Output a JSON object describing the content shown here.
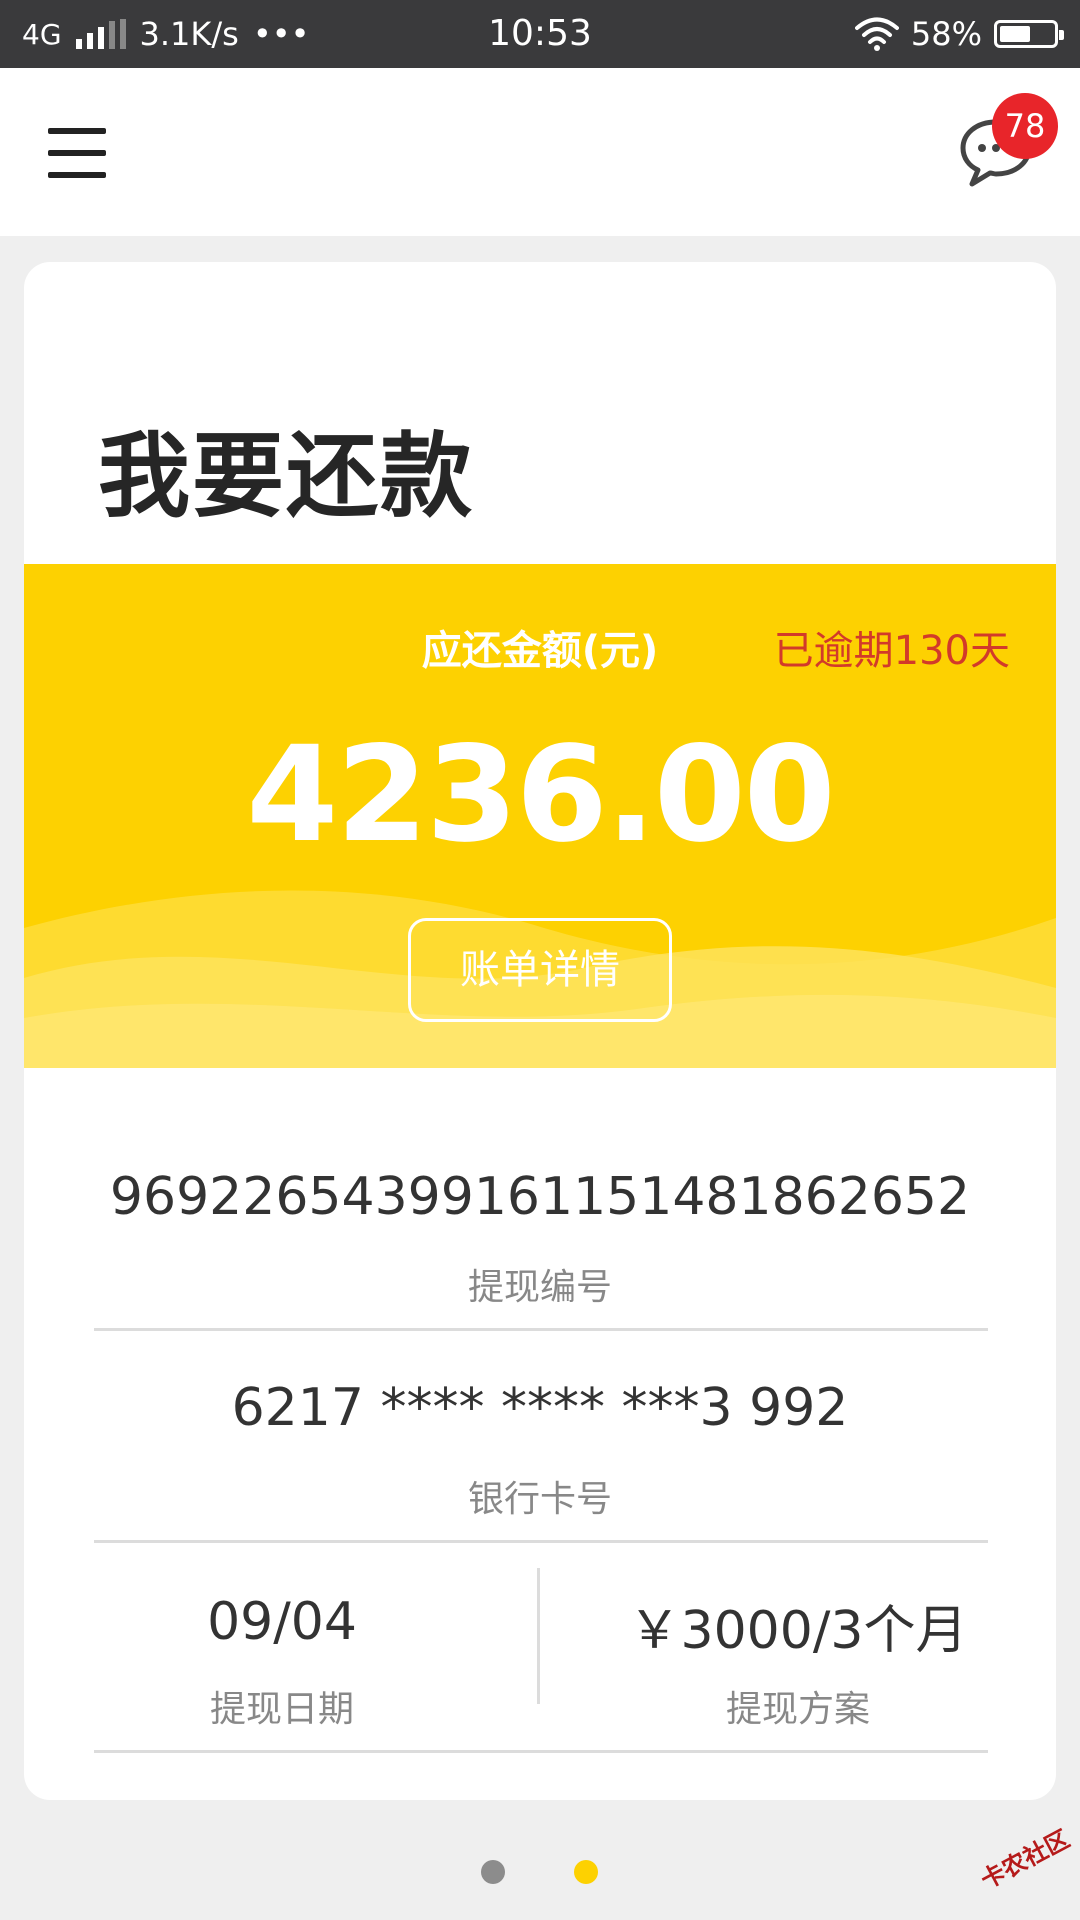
{
  "status_bar": {
    "network": "4G",
    "speed": "3.1K/s",
    "more": "•••",
    "time": "10:53",
    "battery": "58%",
    "battery_level": 0.58
  },
  "header": {
    "menu_icon": "hamburger-menu-icon",
    "chat_icon": "chat-bubble-icon",
    "badge_count": "78"
  },
  "page": {
    "title": "我要还款"
  },
  "banner": {
    "amount_label": "应还金额(元)",
    "overdue": "已逾期130天",
    "amount": "4236.00",
    "bill_button": "账单详情",
    "color": "#fdd101",
    "overdue_color": "#d23a2a"
  },
  "details": {
    "withdraw_number": {
      "value": "969226543991611514818626​52",
      "label": "提现编号"
    },
    "bank_card": {
      "value": "6217 **** **** ***3 992",
      "label": "银行卡号"
    },
    "withdraw_date": {
      "value": "09/04",
      "label": "提现日期"
    },
    "withdraw_plan": {
      "value": "￥3000/3个月",
      "label": "提现方案"
    }
  },
  "pager": {
    "total": 2,
    "active": 2
  },
  "watermark": "卡农社区"
}
